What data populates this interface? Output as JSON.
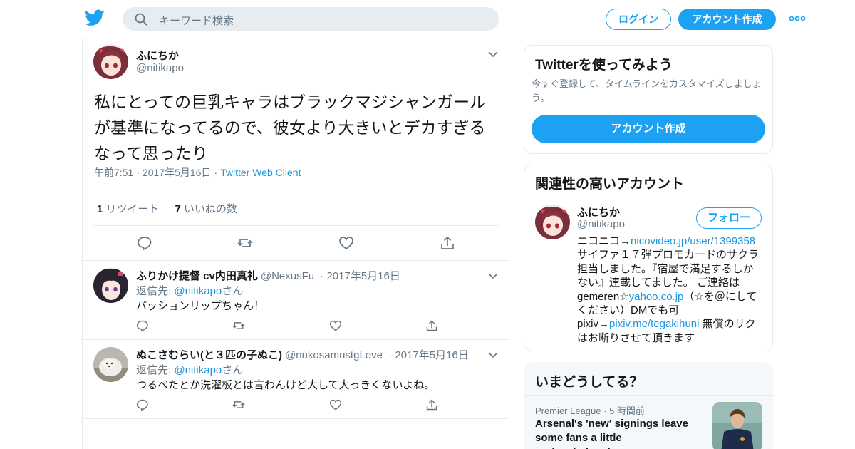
{
  "header": {
    "search_placeholder": "キーワード検索",
    "login_label": "ログイン",
    "signup_label": "アカウント作成"
  },
  "tweet": {
    "name": "ふにちか",
    "handle": "@nitikapo",
    "text": "私にとっての巨乳キャラはブラックマジシャンガールが基準になってるので、彼女より大きいとデカすぎるなって思ったり",
    "time": "午前7:51",
    "date": "2017年5月16日",
    "client": "Twitter Web Client",
    "retweet_count": "1",
    "retweet_label": "リツイート",
    "like_count": "7",
    "like_label": "いいねの数"
  },
  "replies": [
    {
      "name": "ふりかけ提督 cv内田真礼",
      "handle": "@NexusFu",
      "date": "2017年5月16日",
      "reply_prefix": "返信先: ",
      "reply_to": "@nitikapo",
      "reply_suffix": "さん",
      "text": "パッションリップちゃん！"
    },
    {
      "name": "ぬこさむらい(と３匹の子ぬこ)",
      "handle": "@nukosamustgLove",
      "date": "2017年5月16日",
      "reply_prefix": "返信先: ",
      "reply_to": "@nitikapo",
      "reply_suffix": "さん",
      "text": "つるぺたとか洗濯板とは言わんけど大して大っきくないよね。"
    }
  ],
  "sidebar": {
    "signup_card": {
      "title": "Twitterを使ってみよう",
      "subtitle": "今すぐ登録して、タイムラインをカスタマイズしましょう。",
      "button": "アカウント作成"
    },
    "related": {
      "title": "関連性の高いアカウント",
      "name": "ふにちか",
      "handle": "@nitikapo",
      "follow_label": "フォロー",
      "bio_1": "ニコニコ→",
      "bio_link_1": "nicovideo.jp/user/1399358",
      "bio_2": "サイファ１７弾プロモカードのサクラ担当しました。『宿屋で満足するしかない』連載してました。 ご連絡は gemeren☆",
      "bio_link_2": "yahoo.co.jp",
      "bio_3": "（☆を＠にしてください）DMでも可 pixiv→",
      "bio_link_3": "pixiv.me/tegakihuni",
      "bio_4": " 無償のリクはお断りさせて頂きます"
    },
    "trends": {
      "title": "いまどうしてる？",
      "context": "Premier League",
      "time": "5 時間前",
      "headline": "Arsenal's 'new' signings leave some fans a little underwhelmed"
    }
  },
  "colors": {
    "brand_blue": "#1da1f2",
    "link_blue": "#1b95e0",
    "muted": "#657786"
  }
}
